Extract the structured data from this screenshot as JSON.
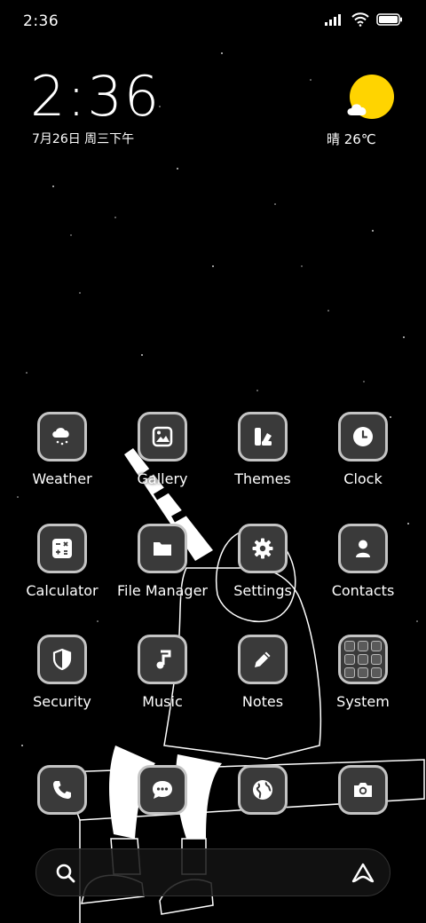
{
  "status_bar": {
    "time": "2:36"
  },
  "lockclock": {
    "time": "2:36",
    "date": "7月26日 周三下午"
  },
  "weather": {
    "text": "晴 26℃"
  },
  "apps": [
    {
      "label": "Weather",
      "icon": "cloud-snow-icon"
    },
    {
      "label": "Gallery",
      "icon": "image-icon"
    },
    {
      "label": "Themes",
      "icon": "themes-icon"
    },
    {
      "label": "Clock",
      "icon": "clock-icon"
    },
    {
      "label": "Calculator",
      "icon": "calculator-icon"
    },
    {
      "label": "File Manager",
      "icon": "folder-icon"
    },
    {
      "label": "Settings",
      "icon": "gear-icon"
    },
    {
      "label": "Contacts",
      "icon": "person-icon"
    },
    {
      "label": "Security",
      "icon": "shield-icon"
    },
    {
      "label": "Music",
      "icon": "music-note-icon"
    },
    {
      "label": "Notes",
      "icon": "pencil-icon"
    },
    {
      "label": "System",
      "icon": "system-folder-icon"
    }
  ],
  "dock": [
    {
      "icon": "phone-icon"
    },
    {
      "icon": "message-icon"
    },
    {
      "icon": "browser-globe-icon"
    },
    {
      "icon": "camera-icon"
    }
  ],
  "search": {
    "icon": "search-icon",
    "assistant_icon": "assistant-icon"
  },
  "colors": {
    "tile_bg": "#3a3a3a",
    "tile_border": "#c4c4c4",
    "sun": "#FFD400",
    "background": "#000000"
  }
}
